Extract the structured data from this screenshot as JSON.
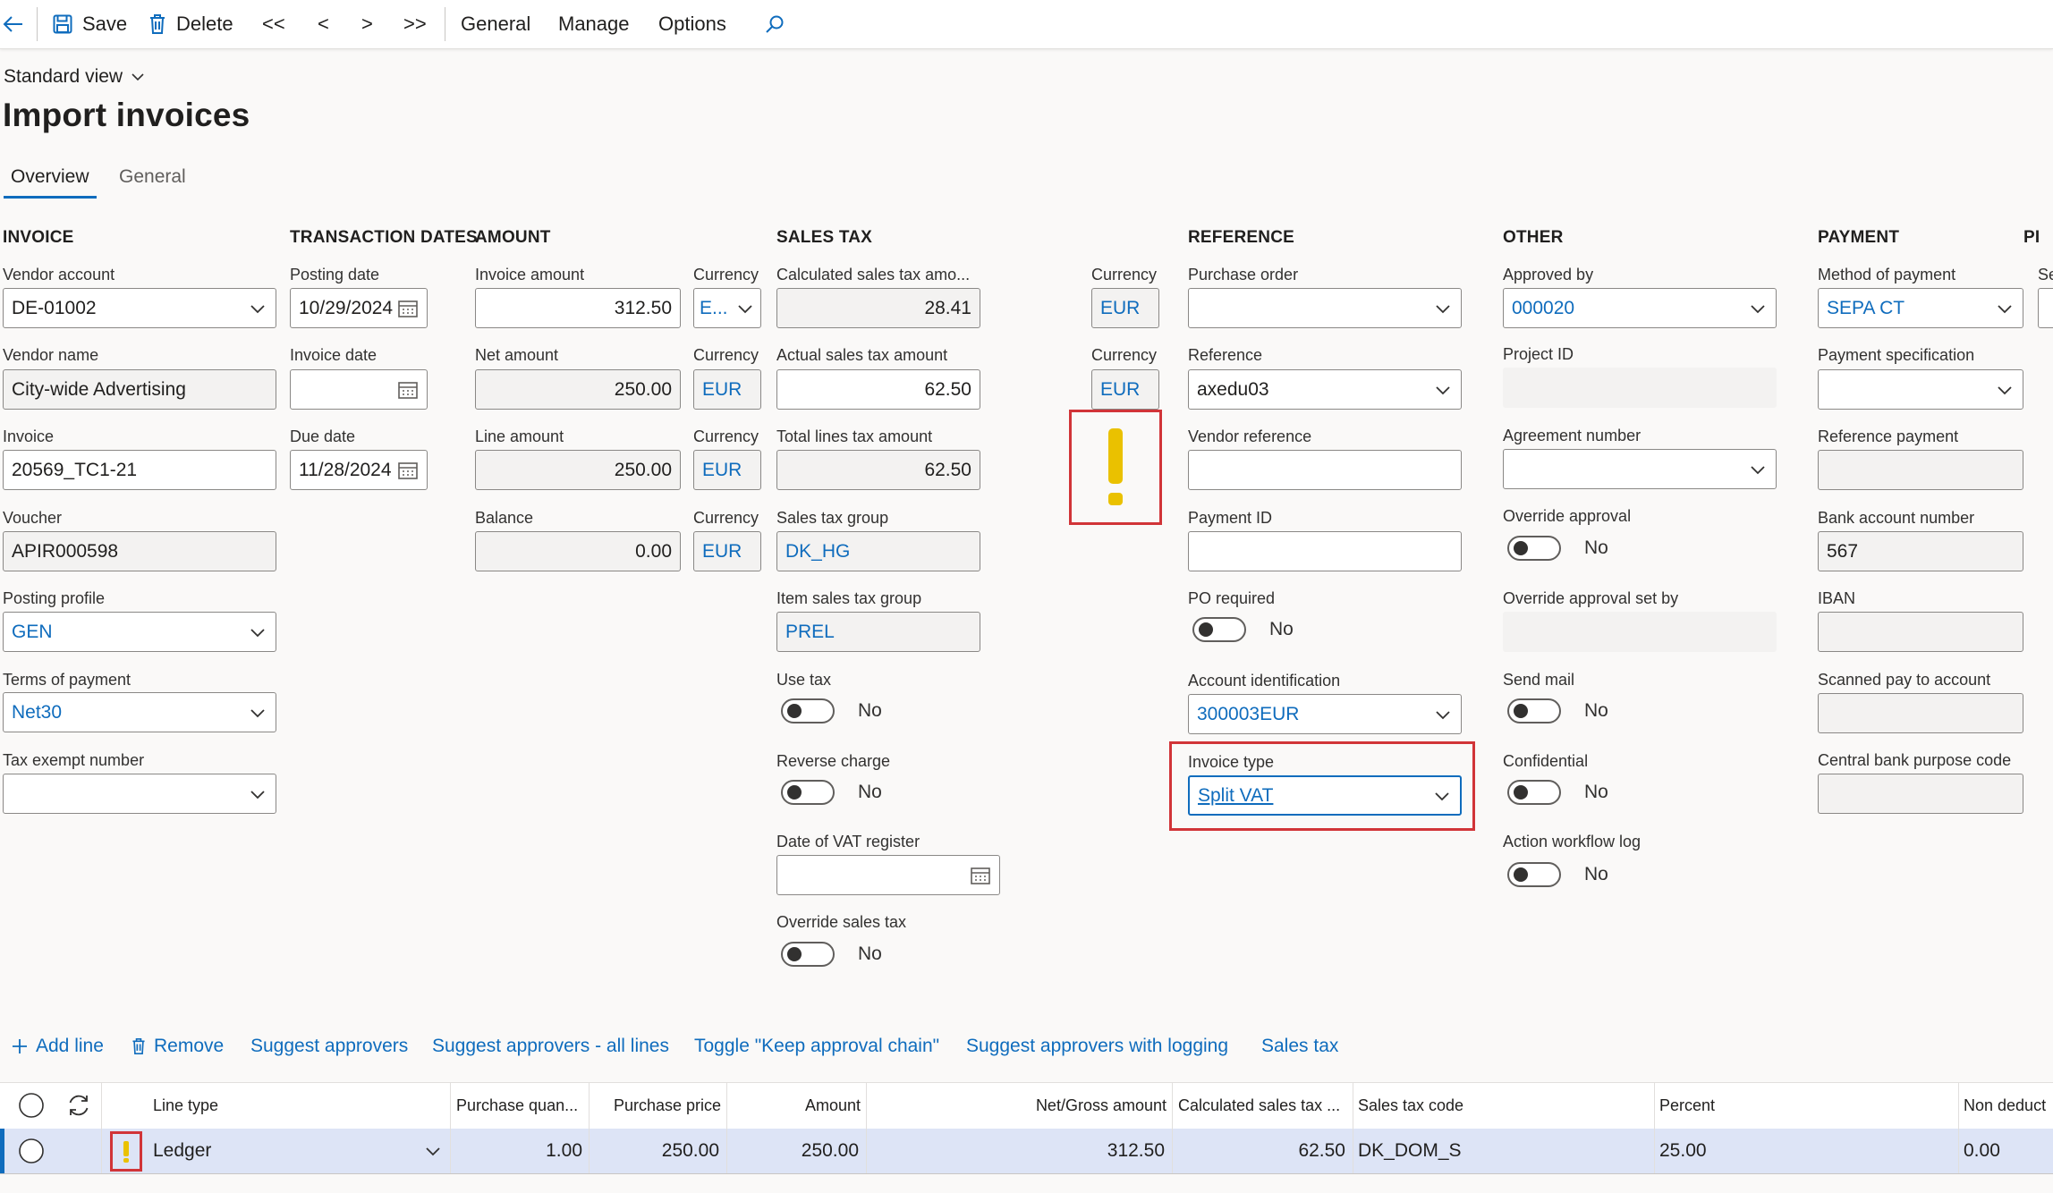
{
  "toolbar": {
    "save_label": "Save",
    "delete_label": "Delete",
    "first_label": "<<",
    "prev_label": "<",
    "next_label": ">",
    "last_label": ">>",
    "general_label": "General",
    "manage_label": "Manage",
    "options_label": "Options"
  },
  "header": {
    "view": "Standard view",
    "title": "Import invoices",
    "tabs": [
      "Overview",
      "General"
    ]
  },
  "sections": {
    "invoice": "INVOICE",
    "dates": "TRANSACTION DATES",
    "amount": "AMOUNT",
    "sales_tax": "SALES TAX",
    "reference": "REFERENCE",
    "other": "OTHER",
    "payment": "PAYMENT",
    "cut": "PI"
  },
  "invoice": {
    "vendor_account_label": "Vendor account",
    "vendor_account": "DE-01002",
    "vendor_name_label": "Vendor name",
    "vendor_name": "City-wide Advertising",
    "invoice_label": "Invoice",
    "invoice": "20569_TC1-21",
    "voucher_label": "Voucher",
    "voucher": "APIR000598",
    "posting_profile_label": "Posting profile",
    "posting_profile": "GEN",
    "terms_label": "Terms of payment",
    "terms": "Net30",
    "tax_exempt_label": "Tax exempt number",
    "tax_exempt": ""
  },
  "dates": {
    "posting_label": "Posting date",
    "posting": "10/29/2024",
    "invoice_label": "Invoice date",
    "invoice": "",
    "due_label": "Due date",
    "due": "11/28/2024"
  },
  "amount": {
    "invoice_amount_label": "Invoice amount",
    "invoice_amount": "312.50",
    "net_amount_label": "Net amount",
    "net_amount": "250.00",
    "line_amount_label": "Line amount",
    "line_amount": "250.00",
    "balance_label": "Balance",
    "balance": "0.00",
    "currency_label": "Currency",
    "currency_short": "E...",
    "currency": "EUR"
  },
  "sales_tax": {
    "calc_label": "Calculated sales tax amo...",
    "calc": "28.41",
    "actual_label": "Actual sales tax amount",
    "actual": "62.50",
    "total_lines_label": "Total lines tax amount",
    "total_lines": "62.50",
    "group_label": "Sales tax group",
    "group": "DK_HG",
    "item_group_label": "Item sales tax group",
    "item_group": "PREL",
    "use_tax_label": "Use tax",
    "use_tax": "No",
    "reverse_label": "Reverse charge",
    "reverse": "No",
    "vat_date_label": "Date of VAT register",
    "vat_date": "",
    "override_label": "Override sales tax",
    "override": "No",
    "currency_label": "Currency",
    "currency": "EUR"
  },
  "reference": {
    "po_label": "Purchase order",
    "po": "",
    "ref_label": "Reference",
    "ref": "axedu03",
    "vendor_ref_label": "Vendor reference",
    "vendor_ref": "",
    "payment_id_label": "Payment ID",
    "payment_id": "",
    "po_required_label": "PO required",
    "po_required": "No",
    "account_id_label": "Account identification",
    "account_id": "300003EUR",
    "invoice_type_label": "Invoice type",
    "invoice_type": "Split VAT"
  },
  "other": {
    "approved_by_label": "Approved by",
    "approved_by": "000020",
    "project_label": "Project ID",
    "project": "",
    "agreement_label": "Agreement number",
    "agreement": "",
    "override_approval_label": "Override approval",
    "override_approval": "No",
    "override_set_by_label": "Override approval set by",
    "override_set_by": "",
    "send_mail_label": "Send mail",
    "send_mail": "No",
    "confidential_label": "Confidential",
    "confidential": "No",
    "workflow_log_label": "Action workflow log",
    "workflow_log": "No"
  },
  "payment": {
    "method_label": "Method of payment",
    "method": "SEPA CT",
    "spec_label": "Payment specification",
    "spec": "",
    "ref_payment_label": "Reference payment",
    "ref_payment": "",
    "bank_label": "Bank account number",
    "bank": "567",
    "iban_label": "IBAN",
    "iban": "",
    "scanned_label": "Scanned pay to account",
    "scanned": "",
    "central_bank_label": "Central bank purpose code",
    "central_bank": "",
    "cut_label": "Se"
  },
  "line_actions": {
    "add_line": "Add line",
    "remove": "Remove",
    "suggest": "Suggest approvers",
    "suggest_all": "Suggest approvers - all lines",
    "toggle": "Toggle \"Keep approval chain\"",
    "suggest_logging": "Suggest approvers with logging",
    "sales_tax": "Sales tax"
  },
  "grid": {
    "headers": [
      "Line type",
      "Purchase quan...",
      "Purchase price",
      "Amount",
      "Net/Gross amount",
      "Calculated sales tax ...",
      "Sales tax code",
      "Percent",
      "Non deduct"
    ],
    "row": {
      "line_type": "Ledger",
      "qty": "1.00",
      "price": "250.00",
      "amount": "250.00",
      "net_gross": "312.50",
      "calc_tax": "62.50",
      "tax_code": "DK_DOM_S",
      "percent": "25.00",
      "non_deduct": "0.00"
    }
  },
  "colors": {
    "accent": "#0f6cbd",
    "warning": "#eac100",
    "highlight_box": "#d13438",
    "selected_row": "#dde4f6"
  }
}
